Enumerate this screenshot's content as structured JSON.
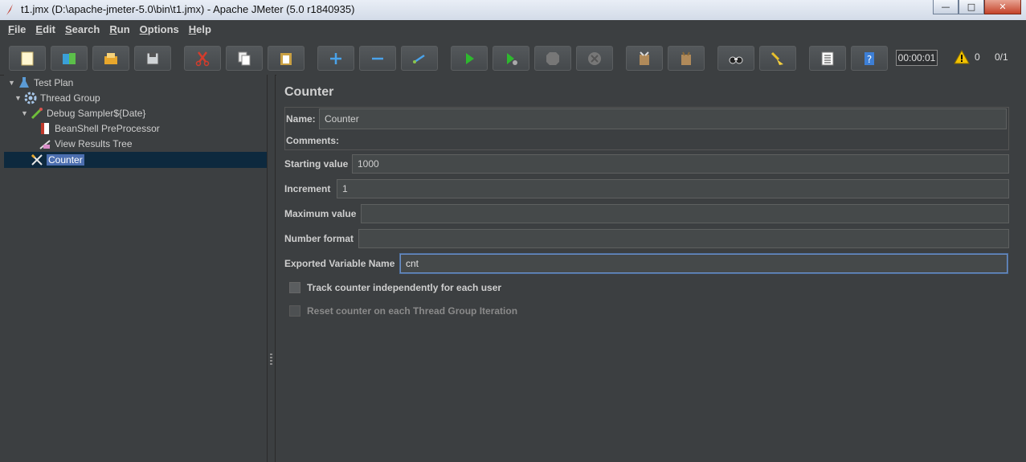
{
  "window": {
    "title": "t1.jmx (D:\\apache-jmeter-5.0\\bin\\t1.jmx) - Apache JMeter (5.0 r1840935)",
    "buttons": [
      "minimize",
      "maximize",
      "close"
    ]
  },
  "menu": [
    "File",
    "Edit",
    "Search",
    "Run",
    "Options",
    "Help"
  ],
  "toolbar": {
    "buttons": [
      {
        "name": "new-icon"
      },
      {
        "name": "templates-icon"
      },
      {
        "name": "open-icon"
      },
      {
        "name": "save-icon"
      },
      {
        "name": "cut-icon"
      },
      {
        "name": "copy-icon"
      },
      {
        "name": "paste-icon"
      },
      {
        "name": "expand-icon"
      },
      {
        "name": "collapse-icon"
      },
      {
        "name": "toggle-icon"
      },
      {
        "name": "start-icon"
      },
      {
        "name": "start-no-pauses-icon"
      },
      {
        "name": "stop-icon"
      },
      {
        "name": "shutdown-icon"
      },
      {
        "name": "remote-start-icon"
      },
      {
        "name": "remote-stop-icon"
      },
      {
        "name": "search-icon"
      },
      {
        "name": "clear-all-icon"
      },
      {
        "name": "function-helper-icon"
      },
      {
        "name": "help-icon"
      }
    ],
    "timer": "00:00:01",
    "warning_count": "0",
    "thread_count": "0/1"
  },
  "tree": {
    "nodes": [
      {
        "label": "Test Plan",
        "icon": "test-plan-icon",
        "level": 0,
        "expanded": true
      },
      {
        "label": "Thread Group",
        "icon": "thread-group-icon",
        "level": 1,
        "expanded": true
      },
      {
        "label": "Debug Sampler${Date}",
        "icon": "debug-sampler-icon",
        "level": 2,
        "expanded": true
      },
      {
        "label": "BeanShell PreProcessor",
        "icon": "beanshell-icon",
        "level": 3
      },
      {
        "label": "View Results Tree",
        "icon": "results-tree-icon",
        "level": 3
      },
      {
        "label": "Counter",
        "icon": "counter-icon",
        "level": 2,
        "selected": true
      }
    ]
  },
  "panel": {
    "title": "Counter",
    "name_label": "Name:",
    "name_value": "Counter",
    "comments_label": "Comments:",
    "comments_value": "",
    "fields": [
      {
        "label": "Starting value",
        "value": "1000"
      },
      {
        "label": "Increment",
        "value": "1"
      },
      {
        "label": "Maximum value",
        "value": ""
      },
      {
        "label": "Number format",
        "value": ""
      },
      {
        "label": "Exported Variable Name",
        "value": "cnt"
      }
    ],
    "checkboxes": [
      {
        "label": "Track counter independently for each user",
        "checked": false,
        "enabled": true
      },
      {
        "label": "Reset counter on each Thread Group Iteration",
        "checked": false,
        "enabled": false
      }
    ]
  },
  "colors": {
    "background": "#3c3f41",
    "selection": "#4b6eaf",
    "focus": "#6a8fc7"
  }
}
